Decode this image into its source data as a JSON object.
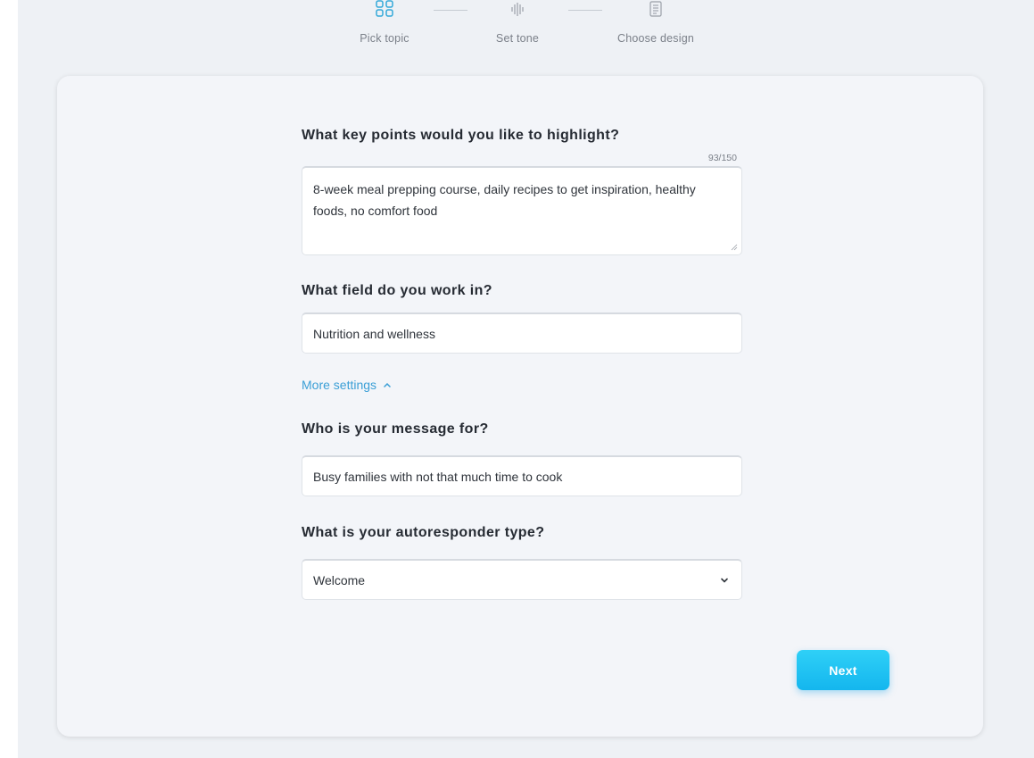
{
  "stepper": {
    "steps": [
      {
        "label": "Pick topic",
        "icon": "grid-icon",
        "state": "active"
      },
      {
        "label": "Set tone",
        "icon": "soundwave-icon",
        "state": "pending"
      },
      {
        "label": "Choose design",
        "icon": "document-icon",
        "state": "pending"
      }
    ]
  },
  "form": {
    "key_points": {
      "label": "What key points would you like to highlight?",
      "counter": "93/150",
      "value": "8-week meal prepping course, daily recipes to get inspiration, healthy foods, no comfort food"
    },
    "field": {
      "label": "What field do you work in?",
      "value": "Nutrition and wellness"
    },
    "more_settings": {
      "label": "More settings",
      "icon": "chevron-up-icon"
    },
    "audience": {
      "label": "Who is your message for?",
      "value": "Busy families with not that much time to cook"
    },
    "autoresponder_type": {
      "label": "What is your autoresponder type?",
      "value": "Welcome",
      "icon": "chevron-down-icon"
    }
  },
  "actions": {
    "next_label": "Next"
  },
  "colors": {
    "accent": "#3b9fd6",
    "button": "#1fc3f2",
    "active_step": "#33a9d9",
    "background": "#eef1f5",
    "card": "#f3f5f9"
  }
}
